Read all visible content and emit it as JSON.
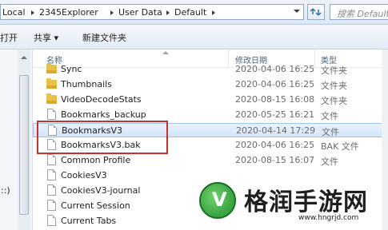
{
  "address": {
    "crumbs": [
      "Local",
      "2345Explorer",
      "User Data",
      "Default"
    ],
    "search_placeholder": "搜索 Default"
  },
  "toolbar": {
    "open_label": "打开",
    "share_label": "共享 ▾",
    "new_folder_label": "新建文件夹"
  },
  "nav": {
    "label": "::)"
  },
  "columns": {
    "name": "名称",
    "modified": "修改日期",
    "type": "类型"
  },
  "files": [
    {
      "name": "Sync",
      "modified": "2020-04-06 16:25",
      "type": "文件夹",
      "icon": "folder-icon"
    },
    {
      "name": "Thumbnails",
      "modified": "2020-04-06 16:25",
      "type": "文件夹",
      "icon": "folder-icon"
    },
    {
      "name": "VideoDecodeStats",
      "modified": "2020-08-15 16:08",
      "type": "文件夹",
      "icon": "folder-icon"
    },
    {
      "name": "Bookmarks_backup",
      "modified": "2020-05-25 16:21",
      "type": "文件",
      "icon": "file-icon"
    },
    {
      "name": "BookmarksV3",
      "modified": "2020-04-14 17:29",
      "type": "文件",
      "icon": "file-icon",
      "selected": true
    },
    {
      "name": "BookmarksV3.bak",
      "modified": "2020-04-06 16:25",
      "type": "BAK 文件",
      "icon": "file-icon"
    },
    {
      "name": "Common Profile",
      "modified": "2020-08-15 16:07",
      "type": "文件",
      "icon": "file-icon"
    },
    {
      "name": "CookiesV3",
      "modified": "",
      "type": "",
      "icon": "file-icon"
    },
    {
      "name": "CookiesV3-journal",
      "modified": "",
      "type": "",
      "icon": "file-icon"
    },
    {
      "name": "Current Session",
      "modified": "",
      "type": "",
      "icon": "file-icon"
    },
    {
      "name": "Current Tabs",
      "modified": "",
      "type": "",
      "icon": "file-icon"
    }
  ],
  "watermark": {
    "title": "格润手游网",
    "url": "www.hngrjd.com"
  },
  "colors": {
    "selection": "#d3e5fa",
    "highlight_border": "#c8302c",
    "folder": "#e8c14a"
  }
}
